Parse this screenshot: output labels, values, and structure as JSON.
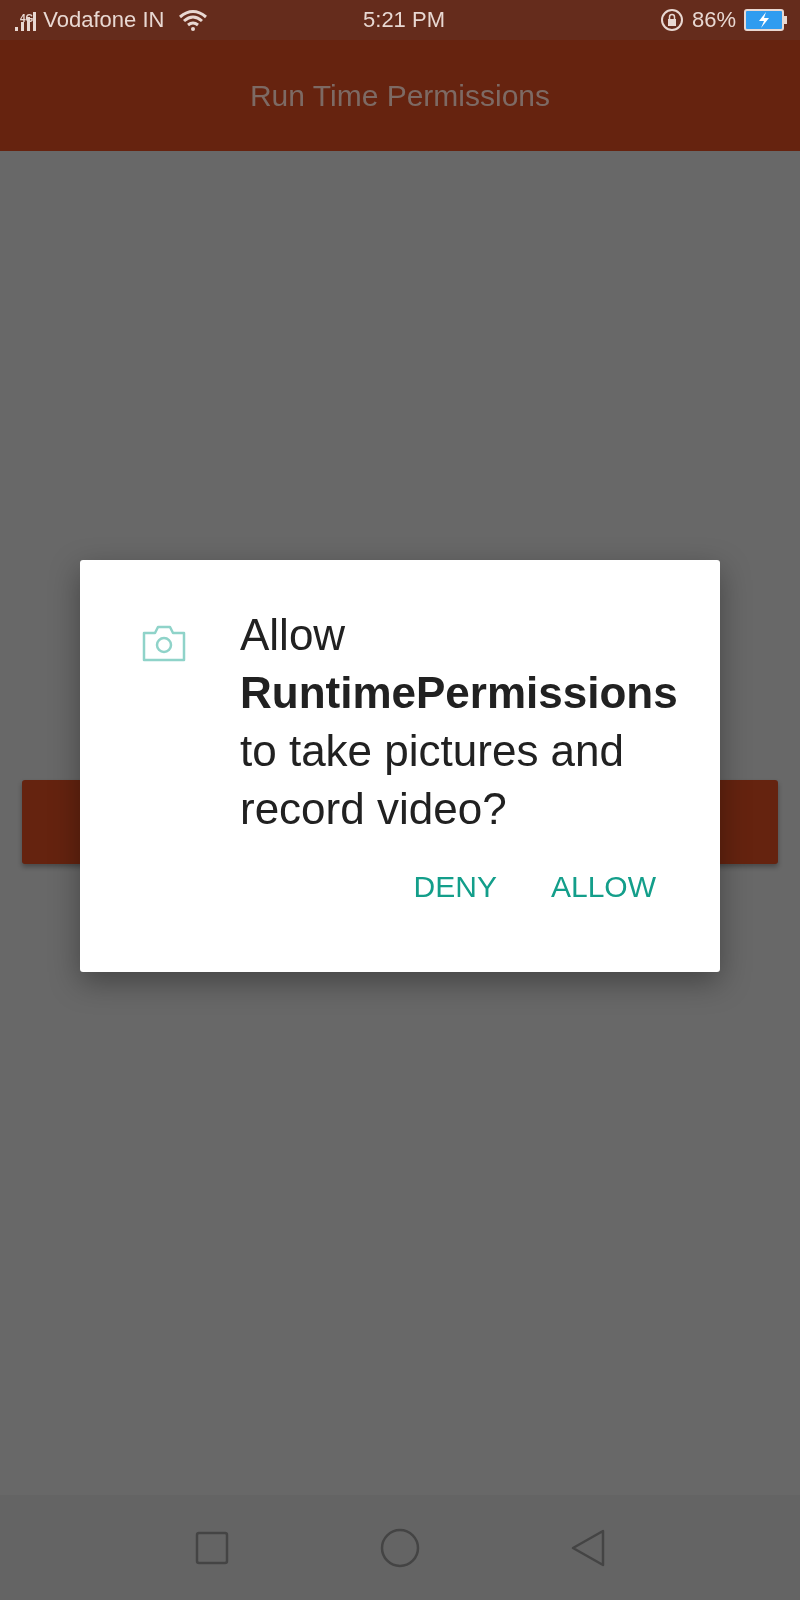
{
  "status_bar": {
    "network": "4G",
    "carrier": "Vodafone IN",
    "time": "5:21 PM",
    "battery": "86%"
  },
  "app_bar": {
    "title": "Run Time Permissions"
  },
  "dialog": {
    "message": "Allow **RuntimePermissions** to take pictures and record video?",
    "buttons": [
      "DENY",
      "ALLOW"
    ]
  }
}
